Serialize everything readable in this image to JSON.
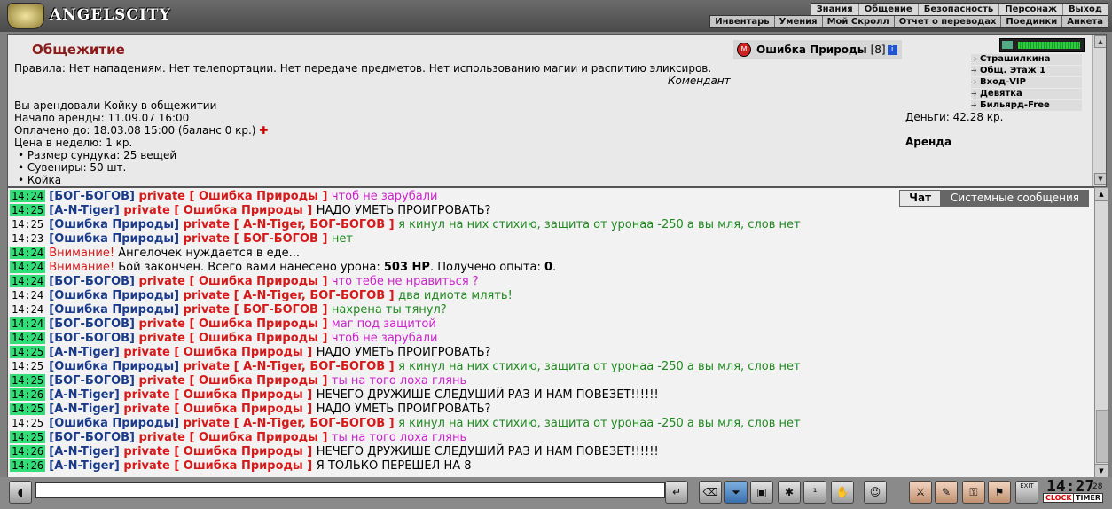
{
  "app": {
    "logo_text": "ANGELSCITY"
  },
  "nav": {
    "top": [
      "Знания",
      "Общение",
      "Безопасность",
      "Персонаж",
      "Выход"
    ],
    "sub": [
      "Инвентарь",
      "Умения",
      "Мой Скролл",
      "Отчет о переводах",
      "Поединки",
      "Анкета"
    ]
  },
  "room": {
    "title": "Общежитие",
    "rules": "Правила: Нет нападениям. Нет телепортации. Нет передаче предметов. Нет использованию магии и распитию эликсиров.",
    "rules_signature": "Комендант",
    "lines": [
      "Вы арендовали Койку в общежитии",
      "Начало аренды: 11.09.07 16:00",
      "Оплачено до: 18.03.08 15:00 (баланс 0 кр.)",
      "Цена в неделю: 1 кр.",
      "• Размер сундука: 25 вещей",
      "• Сувениры: 50 шт.",
      "• Койка"
    ],
    "money": "Деньги: 42.28 кр.",
    "rent": "Аренда"
  },
  "player": {
    "name": "Ошибка Природы",
    "level": "[8]",
    "info_icon": "i",
    "align_icon": "M"
  },
  "locations": [
    "Страшилкина улица",
    "Общ. Этаж 1",
    "Вход-VIP",
    "Девятка",
    "Бильярд-Free"
  ],
  "chat": {
    "tabs": [
      "Чат",
      "Системные сообщения"
    ],
    "messages": [
      {
        "time": "14:24",
        "hl": true,
        "parts": [
          {
            "t": "[БОГ-БОГОВ] ",
            "c": "nick"
          },
          {
            "t": "private [ Ошибка Природы ] ",
            "c": "priv"
          },
          {
            "t": "чтоб не зарубали",
            "c": "t-magenta"
          }
        ]
      },
      {
        "time": "14:25",
        "hl": true,
        "parts": [
          {
            "t": "[A-N-Tiger] ",
            "c": "nick"
          },
          {
            "t": "private [ Ошибка Природы ] ",
            "c": "priv"
          },
          {
            "t": "НАДО УМЕТЬ ПРОИГРОВАТЬ?",
            "c": "t-black"
          }
        ]
      },
      {
        "time": "14:25",
        "hl": false,
        "parts": [
          {
            "t": "[Ошибка Природы] ",
            "c": "nick"
          },
          {
            "t": "private [ A-N-Tiger, БОГ-БОГОВ ] ",
            "c": "priv"
          },
          {
            "t": "я кинул на них стихию, защита от уронаа -250 а вы мля, слов нет",
            "c": "t-green"
          }
        ]
      },
      {
        "time": "14:23",
        "hl": false,
        "parts": [
          {
            "t": "[Ошибка Природы] ",
            "c": "nick"
          },
          {
            "t": "private [ БОГ-БОГОВ ] ",
            "c": "priv"
          },
          {
            "t": "нет",
            "c": "t-green"
          }
        ]
      },
      {
        "time": "14:24",
        "hl": true,
        "parts": [
          {
            "t": "Внимание! ",
            "c": "t-red"
          },
          {
            "t": "Ангелочек нуждается в еде...",
            "c": "t-black"
          }
        ]
      },
      {
        "time": "14:24",
        "hl": true,
        "parts": [
          {
            "t": "Внимание! ",
            "c": "t-red"
          },
          {
            "t": "Бой закончен. Всего вами нанесено урона: ",
            "c": "t-black"
          },
          {
            "t": "503 HP",
            "c": "t-black b"
          },
          {
            "t": ". Получено опыта: ",
            "c": "t-black"
          },
          {
            "t": "0",
            "c": "t-black b"
          },
          {
            "t": ".",
            "c": "t-black"
          }
        ]
      },
      {
        "time": "14:24",
        "hl": true,
        "parts": [
          {
            "t": "[БОГ-БОГОВ] ",
            "c": "nick"
          },
          {
            "t": "private [ Ошибка Природы ] ",
            "c": "priv"
          },
          {
            "t": "что тебе не нравиться ?",
            "c": "t-magenta"
          }
        ]
      },
      {
        "time": "14:24",
        "hl": false,
        "parts": [
          {
            "t": "[Ошибка Природы] ",
            "c": "nick"
          },
          {
            "t": "private [ A-N-Tiger, БОГ-БОГОВ ] ",
            "c": "priv"
          },
          {
            "t": "два идиота млять!",
            "c": "t-green"
          }
        ]
      },
      {
        "time": "14:24",
        "hl": false,
        "parts": [
          {
            "t": "[Ошибка Природы] ",
            "c": "nick"
          },
          {
            "t": "private [ БОГ-БОГОВ ] ",
            "c": "priv"
          },
          {
            "t": "нахрена ты тянул?",
            "c": "t-green"
          }
        ]
      },
      {
        "time": "14:24",
        "hl": true,
        "parts": [
          {
            "t": "[БОГ-БОГОВ] ",
            "c": "nick"
          },
          {
            "t": "private [ Ошибка Природы ] ",
            "c": "priv"
          },
          {
            "t": "маг под защитой",
            "c": "t-magenta"
          }
        ]
      },
      {
        "time": "14:24",
        "hl": true,
        "parts": [
          {
            "t": "[БОГ-БОГОВ] ",
            "c": "nick"
          },
          {
            "t": "private [ Ошибка Природы ] ",
            "c": "priv"
          },
          {
            "t": "чтоб не зарубали",
            "c": "t-magenta"
          }
        ]
      },
      {
        "time": "14:25",
        "hl": true,
        "parts": [
          {
            "t": "[A-N-Tiger] ",
            "c": "nick"
          },
          {
            "t": "private [ Ошибка Природы ] ",
            "c": "priv"
          },
          {
            "t": "НАДО УМЕТЬ ПРОИГРОВАТЬ?",
            "c": "t-black"
          }
        ]
      },
      {
        "time": "14:25",
        "hl": false,
        "parts": [
          {
            "t": "[Ошибка Природы] ",
            "c": "nick"
          },
          {
            "t": "private [ A-N-Tiger, БОГ-БОГОВ ] ",
            "c": "priv"
          },
          {
            "t": "я кинул на них стихию, защита от уронаа -250 а вы мля, слов нет",
            "c": "t-green"
          }
        ]
      },
      {
        "time": "14:25",
        "hl": true,
        "parts": [
          {
            "t": "[БОГ-БОГОВ] ",
            "c": "nick"
          },
          {
            "t": "private [ Ошибка Природы ] ",
            "c": "priv"
          },
          {
            "t": "ты на того лоха глянь",
            "c": "t-magenta"
          }
        ]
      },
      {
        "time": "14:26",
        "hl": true,
        "parts": [
          {
            "t": "[A-N-Tiger] ",
            "c": "nick"
          },
          {
            "t": "private [ Ошибка Природы ] ",
            "c": "priv"
          },
          {
            "t": "НЕЧЕГО ДРУЖИШЕ СЛЕДУШИЙ РАЗ И НАМ ПОВЕЗЕТ!!!!!!",
            "c": "t-black"
          }
        ]
      },
      {
        "time": "14:25",
        "hl": true,
        "parts": [
          {
            "t": "[A-N-Tiger] ",
            "c": "nick"
          },
          {
            "t": "private [ Ошибка Природы ] ",
            "c": "priv"
          },
          {
            "t": "НАДО УМЕТЬ ПРОИГРОВАТЬ?",
            "c": "t-black"
          }
        ]
      },
      {
        "time": "14:25",
        "hl": false,
        "parts": [
          {
            "t": "[Ошибка Природы] ",
            "c": "nick"
          },
          {
            "t": "private [ A-N-Tiger, БОГ-БОГОВ ] ",
            "c": "priv"
          },
          {
            "t": "я кинул на них стихию, защита от уронаа -250 а вы мля, слов нет",
            "c": "t-green"
          }
        ]
      },
      {
        "time": "14:25",
        "hl": true,
        "parts": [
          {
            "t": "[БОГ-БОГОВ] ",
            "c": "nick"
          },
          {
            "t": "private [ Ошибка Природы ] ",
            "c": "priv"
          },
          {
            "t": "ты на того лоха глянь",
            "c": "t-magenta"
          }
        ]
      },
      {
        "time": "14:26",
        "hl": true,
        "parts": [
          {
            "t": "[A-N-Tiger] ",
            "c": "nick"
          },
          {
            "t": "private [ Ошибка Природы ] ",
            "c": "priv"
          },
          {
            "t": "НЕЧЕГО ДРУЖИШЕ СЛЕДУШИЙ РАЗ И НАМ ПОВЕЗЕТ!!!!!!",
            "c": "t-black"
          }
        ]
      },
      {
        "time": "14:26",
        "hl": true,
        "parts": [
          {
            "t": "[A-N-Tiger] ",
            "c": "nick"
          },
          {
            "t": "private [ Ошибка Природы ] ",
            "c": "priv"
          },
          {
            "t": "Я ТОЛЬКО ПЕРЕШЕЛ НА 8",
            "c": "t-black"
          }
        ]
      }
    ]
  },
  "clock": {
    "time": "14:27",
    "seconds": "28",
    "clock_label": "CLOCK",
    "timer_label": "TIMER",
    "exit_label": "EXIT"
  },
  "colors": {
    "nick": "#1a3a8a",
    "private": "#d61a1a",
    "time_highlight": "#33dd77",
    "room_title": "#8b1a1a"
  }
}
